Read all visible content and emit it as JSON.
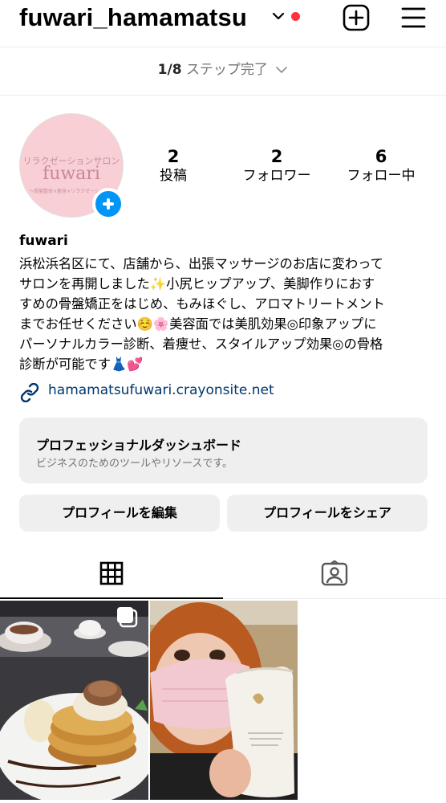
{
  "header": {
    "username": "fuwari_hamamatsu",
    "notification_color": "#ff3040"
  },
  "steps": {
    "progress": "1/8",
    "label": "ステップ完了"
  },
  "avatar": {
    "line1": "リラクゼーションサロン",
    "line2": "fuwari",
    "line3": "〜骨盤整体×瘦身×リラクゼーション〜"
  },
  "stats": [
    {
      "value": "2",
      "label": "投稿"
    },
    {
      "value": "2",
      "label": "フォロワー"
    },
    {
      "value": "6",
      "label": "フォロー中"
    }
  ],
  "profile": {
    "name": "fuwari",
    "bio": "浜松浜名区にて、店舗から、出張マッサージのお店に変わって\nサロンを再開しました✨小尻ヒップアップ、美脚作りにおす\nすめの骨盤矯正をはじめ、もみほぐし、アロマトリートメント\nまでお任せください☺️🌸美容面では美肌効果◎印象アップに\nパーソナルカラー診断、着痩せ、スタイルアップ効果◎の骨格\n診断が可能です👗💕",
    "link": "hamamatsufuwari.crayonsite.net"
  },
  "dashboard": {
    "title": "プロフェッショナルダッシュボード",
    "subtitle": "ビジネスのためのツールやリソースです。"
  },
  "buttons": {
    "edit": "プロフィールを編集",
    "share": "プロフィールをシェア"
  },
  "tabs": [
    "grid-icon",
    "tagged-icon"
  ],
  "colors": {
    "accent": "#0095f6",
    "link": "#00376b",
    "secondary_text": "#737373",
    "button_bg": "#efefef"
  }
}
